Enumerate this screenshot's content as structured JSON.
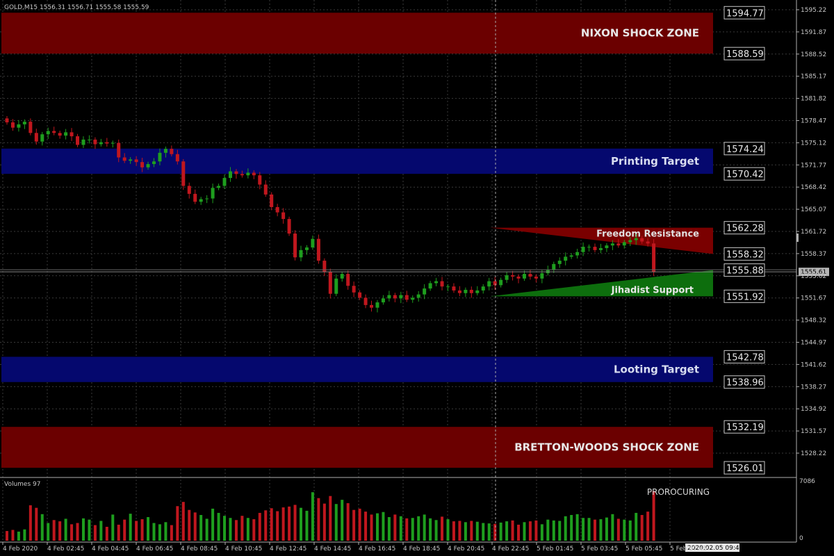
{
  "header": {
    "symbol_info": "GOLD,M15  1556.31 1556.71 1555.58 1555.59"
  },
  "colors": {
    "background": "#000000",
    "grid": "#3a3a3a",
    "axis_text": "#c8c8c8",
    "bull": "#1e9e1e",
    "bear": "#c0171e",
    "shock_zone": "#6b0000",
    "target_zone": "#05086e",
    "resistance": "#7a0000",
    "support": "#0d6e0d",
    "price_label_border": "#c8c8c8"
  },
  "price_axis": {
    "min": 1524.9,
    "max": 1597.0,
    "ticks": [
      "1595.22",
      "1591.87",
      "1588.52",
      "1585.17",
      "1581.82",
      "1578.47",
      "1575.12",
      "1571.77",
      "1568.42",
      "1565.07",
      "1561.72",
      "1558.37",
      "1555.02",
      "1551.67",
      "1548.32",
      "1544.97",
      "1541.62",
      "1538.27",
      "1534.92",
      "1531.57",
      "1528.22"
    ],
    "current_price": "1555.61"
  },
  "zones": [
    {
      "label": "NIXON SHOCK ZONE",
      "top": "1594.77",
      "bottom": "1588.59",
      "kind": "shock"
    },
    {
      "label": "Printing Target",
      "top": "1574.24",
      "bottom": "1570.42",
      "kind": "target"
    },
    {
      "label": "Looting Target",
      "top": "1542.78",
      "bottom": "1538.96",
      "kind": "target"
    },
    {
      "label": "BRETTON-WOODS SHOCK ZONE",
      "top": "1532.19",
      "bottom": "1526.01",
      "kind": "shock"
    }
  ],
  "resistance": {
    "label": "Freedom Resistance",
    "top": "1562.28",
    "bottom": "1558.32"
  },
  "support": {
    "label": "Jihadist Support",
    "top": "1555.88",
    "bottom": "1551.92"
  },
  "volume_panel": {
    "title": "Volumes 97",
    "max_label": "7086",
    "zero_label": "0",
    "max_value": 7086,
    "annotation": "PROROCURING"
  },
  "time_axis": {
    "labels": [
      "4 Feb 2020",
      "4 Feb 02:45",
      "4 Feb 04:45",
      "4 Feb 06:45",
      "4 Feb 08:45",
      "4 Feb 10:45",
      "4 Feb 12:45",
      "4 Feb 14:45",
      "4 Feb 16:45",
      "4 Feb 18:45",
      "4 Feb 20:45",
      "4 Feb 22:45",
      "5 Feb 01:45",
      "5 Feb 03:45",
      "5 Feb 05:45",
      "5 Feb 07:45"
    ],
    "cursor_time": "2020.02.05 09:45"
  },
  "chart_data": {
    "type": "candlestick",
    "series": [
      {
        "name": "",
        "close": [
          1578.2,
          1577.4,
          1577.9,
          1578.3,
          1576.6,
          1575.3,
          1576.4,
          1576.9,
          1576.6,
          1576.2,
          1576.7,
          1576.1,
          1574.8,
          1575.6,
          1575.6,
          1574.9,
          1575.2,
          1575.0,
          1575.1,
          1572.9,
          1572.4,
          1572.6,
          1572.2,
          1571.4,
          1571.9,
          1572.3,
          1573.6,
          1574.2,
          1573.4,
          1572.3,
          1568.6,
          1567.4,
          1566.2,
          1566.6,
          1566.7,
          1568.3,
          1568.6,
          1569.8,
          1570.8,
          1570.4,
          1570.2,
          1570.6,
          1570.2,
          1568.8,
          1567.3,
          1565.4,
          1564.6,
          1563.6,
          1561.4,
          1557.8,
          1558.9,
          1559.3,
          1560.6,
          1557.3,
          1555.6,
          1552.3,
          1554.6,
          1555.3,
          1553.5,
          1552.5,
          1551.7,
          1550.6,
          1550.2,
          1551.0,
          1551.6,
          1552.1,
          1551.6,
          1552.1,
          1551.4,
          1551.7,
          1552.2,
          1553.1,
          1553.9,
          1554.2,
          1553.4,
          1553.4,
          1552.8,
          1552.4,
          1552.9,
          1552.4,
          1552.8,
          1553.4,
          1554.2,
          1553.6,
          1554.4,
          1555.1,
          1554.9,
          1554.6,
          1555.3,
          1554.9,
          1554.6,
          1555.4,
          1555.9,
          1556.8,
          1557.3,
          1557.9,
          1558.1,
          1558.6,
          1559.4,
          1559.4,
          1558.9,
          1559.2,
          1559.6,
          1559.9,
          1559.6,
          1560.1,
          1560.4,
          1560.7,
          1560.2,
          1559.9,
          1555.6
        ],
        "volume": [
          1150,
          1280,
          1080,
          1340,
          4200,
          3900,
          3150,
          2100,
          2450,
          2300,
          2600,
          1950,
          2100,
          2650,
          2500,
          1850,
          2350,
          1650,
          3100,
          1900,
          2500,
          3200,
          2350,
          2550,
          2800,
          2100,
          1950,
          2200,
          1850,
          4100,
          4600,
          3650,
          3350,
          3050,
          2600,
          3800,
          3300,
          2950,
          2700,
          2450,
          2950,
          2700,
          2550,
          3300,
          3600,
          3850,
          3500,
          3950,
          4050,
          4250,
          3900,
          3550,
          5750,
          5050,
          4400,
          5300,
          4350,
          4850,
          4450,
          3650,
          3800,
          3450,
          3100,
          3250,
          3400,
          2800,
          3100,
          2900,
          2650,
          2700,
          2900,
          3100,
          2650,
          2450,
          2850,
          2550,
          2300,
          2350,
          2200,
          2350,
          2250,
          2100,
          2050,
          2000,
          2150,
          2300,
          2400,
          1900,
          2200,
          2300,
          2400,
          1950,
          2500,
          2400,
          2350,
          2900,
          3050,
          3150,
          2700,
          2700,
          2500,
          2550,
          2750,
          3150,
          2600,
          2500,
          2400,
          3300,
          3050,
          3450,
          5900
        ]
      }
    ]
  }
}
